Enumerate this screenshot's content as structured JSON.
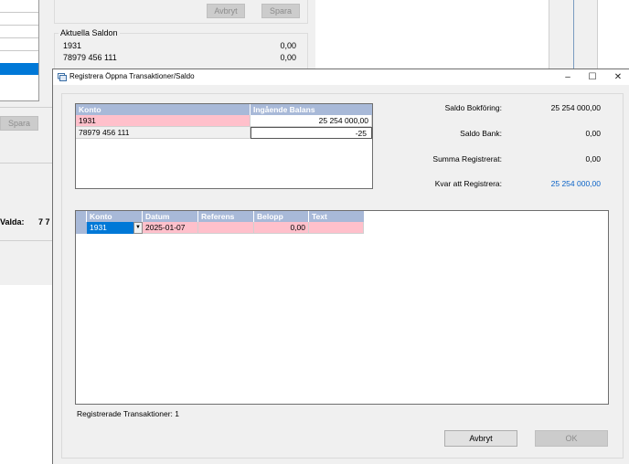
{
  "background": {
    "top_buttons": {
      "cancel": "Avbryt",
      "save": "Spara"
    },
    "saldo_group_title": "Aktuella Saldon",
    "saldo_rows": [
      {
        "account": "1931",
        "amount": "0,00"
      },
      {
        "account": "78979 456 111",
        "amount": "0,00"
      }
    ],
    "left_save_button": "Spara",
    "selected_label": "Valda:",
    "selected_value": "7 7"
  },
  "dialog": {
    "title": "Registrera Öppna Transaktioner/Saldo",
    "controls": {
      "minimize": "–",
      "maximize": "☐",
      "close": "✕"
    },
    "balance_grid": {
      "headers": [
        "Konto",
        "Ingående Balans"
      ],
      "rows": [
        {
          "konto": "1931",
          "balans": "25 254 000,00"
        },
        {
          "konto": "78979 456 111",
          "balans": "-25"
        }
      ]
    },
    "summary": {
      "bokforing_label": "Saldo Bokföring:",
      "bokforing_value": "25 254 000,00",
      "bank_label": "Saldo Bank:",
      "bank_value": "0,00",
      "registrerat_label": "Summa Registrerat:",
      "registrerat_value": "0,00",
      "kvar_label": "Kvar att Registrera:",
      "kvar_value": "25 254 000,00"
    },
    "transactions_grid": {
      "headers": [
        "Konto",
        "Datum",
        "Referens",
        "Belopp",
        "Text"
      ],
      "rows": [
        {
          "konto": "1931",
          "datum": "2025-01-07",
          "referens": "",
          "belopp": "0,00",
          "text": ""
        }
      ]
    },
    "status_text": "Registrerade Transaktioner: 1",
    "buttons": {
      "cancel": "Avbryt",
      "ok": "OK"
    },
    "colors": {
      "header": "#a8b9d8",
      "required_cell": "#ffc0cb",
      "selection": "#0078d7",
      "highlight_value": "#0b63c7"
    }
  }
}
